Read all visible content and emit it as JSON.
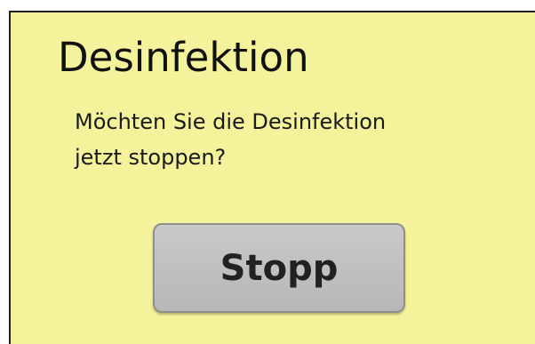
{
  "dialog": {
    "title": "Desinfektion",
    "message_line1": "Möchten Sie die Desinfektion",
    "message_line2": "jetzt stoppen?",
    "stop_button_label": "Stopp",
    "background_color": "#f4f29a",
    "button_color": "#bfbfbf"
  }
}
